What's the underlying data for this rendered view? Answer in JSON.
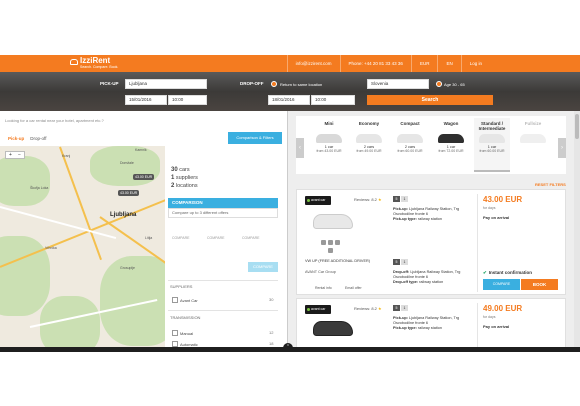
{
  "header": {
    "logo_name": "IzziRent",
    "logo_tagline": "Search. Compare. Book.",
    "links": [
      "info@izzirent.com",
      "Phone: +44 20 81 33 43 36",
      "EUR",
      "EN",
      "Log in"
    ]
  },
  "search": {
    "pickup_label": "PICK-UP",
    "pickup_location": "Ljubljana",
    "pickup_date": "15/01/2016",
    "pickup_time": "10:00",
    "dropoff_label": "DROP-OFF",
    "return_same": "Return to same location",
    "dropoff_date": "18/01/2016",
    "dropoff_time": "10:00",
    "country": "Slovenia",
    "age_label": "Age 30 - 65",
    "search_button": "Search"
  },
  "left": {
    "hint": "Looking for a car rental near your hotel, apartment etc.?",
    "tab_pickup": "Pick-up",
    "tab_dropoff": "Drop-off",
    "comp_filters_button": "Comparison & Filters",
    "zoom_in": "+",
    "zoom_out": "−",
    "summary": {
      "cars_num": "30",
      "cars_label": "cars",
      "suppliers_num": "1",
      "suppliers_label": "suppliers",
      "locations_num": "2",
      "locations_label": "locations"
    },
    "comparison_title": "COMPARISON",
    "comparison_sub": "Compare up to 3 different offers",
    "compare_slots": [
      "COMPARE",
      "COMPARE",
      "COMPARE"
    ],
    "compare_button": "COMPARE",
    "suppliers_title": "SUPPLIERS",
    "supplier": {
      "name": "Avant Car",
      "count": "30"
    },
    "transmission_title": "TRANSMISSION",
    "transmission": [
      {
        "name": "Manual",
        "count": "12"
      },
      {
        "name": "Automatic",
        "count": "18"
      }
    ]
  },
  "map": {
    "city": "Ljubljana",
    "pins": [
      "43.00 EUR",
      "43.00 EUR"
    ],
    "towns": [
      "Kranj",
      "Škofja Loka",
      "Vrhnika",
      "Domžale",
      "Kamnik",
      "Grosuplje",
      "Litija"
    ]
  },
  "categories": [
    {
      "name": "Mini",
      "count": "1 car",
      "price": "from 43.00 EUR",
      "color": "#d9d9d9"
    },
    {
      "name": "Economy",
      "count": "2 cars",
      "price": "from 49.00 EUR",
      "color": "#e6e6e6"
    },
    {
      "name": "Compact",
      "count": "2 cars",
      "price": "from 60.00 EUR",
      "color": "#e6e6e6"
    },
    {
      "name": "Wagon",
      "count": "1 car",
      "price": "from 72.00 EUR",
      "color": "#2f2f2f"
    },
    {
      "name": "Standard / Intermediate",
      "count": "1 car",
      "price": "from 60.00 EUR",
      "color": "#e6e6e6"
    },
    {
      "name": "Fullsize",
      "count": "",
      "price": "",
      "color": "#d0d0d0"
    }
  ],
  "reset_filters": "RESET FILTERS",
  "offers": [
    {
      "supplier_logo": "avant car",
      "reviews": "Reviews: 8.2",
      "title": "VW UP (FREE ADDITIONAL DRIVER)",
      "supplier": "AVANT Car Group",
      "rental_info": "Rental info",
      "email_offer": "Email offer",
      "pickup_title": "Pick-up:",
      "pickup_text": "Ljubljana Railway Station, Trg Osvobodilne fronte 6",
      "pickup_type": "Pick-up type:",
      "pickup_type_val": "railway station",
      "dropoff_title": "Drop-off:",
      "dropoff_text": "Ljubljana Railway Station, Trg Osvobodilne fronte 6",
      "dropoff_type": "Drop-off type:",
      "dropoff_type_val": "railway station",
      "price": "43.00 EUR",
      "per_days": "for days",
      "pay": "Pay on arrival",
      "instant": "Instant confirmation",
      "compare": "COMPARE",
      "book": "BOOK",
      "pill_a": "5",
      "pill_b": "1"
    },
    {
      "supplier_logo": "avant car",
      "reviews": "Reviews: 8.2",
      "pickup_title": "Pick-up:",
      "pickup_text": "Ljubljana Railway Station, Trg Osvobodilne fronte 6",
      "pickup_type": "Pick-up type:",
      "pickup_type_val": "railway station",
      "price": "49.00 EUR",
      "per_days": "for days",
      "pay": "Pay on arrival",
      "pill_a": "5",
      "pill_b": "1"
    }
  ]
}
